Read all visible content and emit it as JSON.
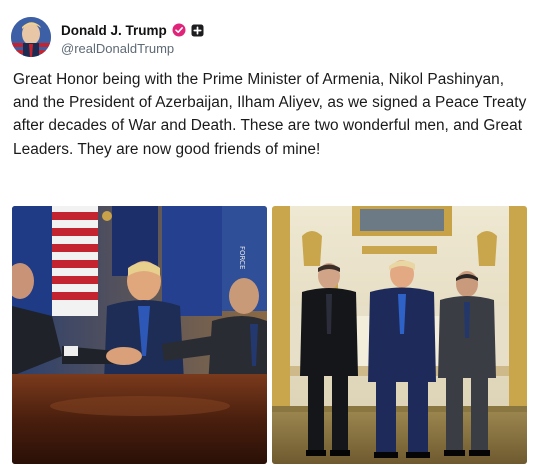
{
  "author": {
    "display_name": "Donald J. Trump",
    "handle": "@realDonaldTrump",
    "verified_icon": "verified-badge-icon",
    "affiliation_icon": "affiliation-plus-icon",
    "verified_color": "#e0247a"
  },
  "post": {
    "text": "Great Honor being with the Prime Minister of Armenia, Nikol Pashinyan, and the President of Azerbaijan, Ilham Aliyev, as we signed a Peace Treaty after decades of War and Death. These are two wonderful men, and Great Leaders. They are now good friends of mine!"
  },
  "media": [
    {
      "name": "handshake-photo"
    },
    {
      "name": "group-portrait-photo"
    }
  ]
}
